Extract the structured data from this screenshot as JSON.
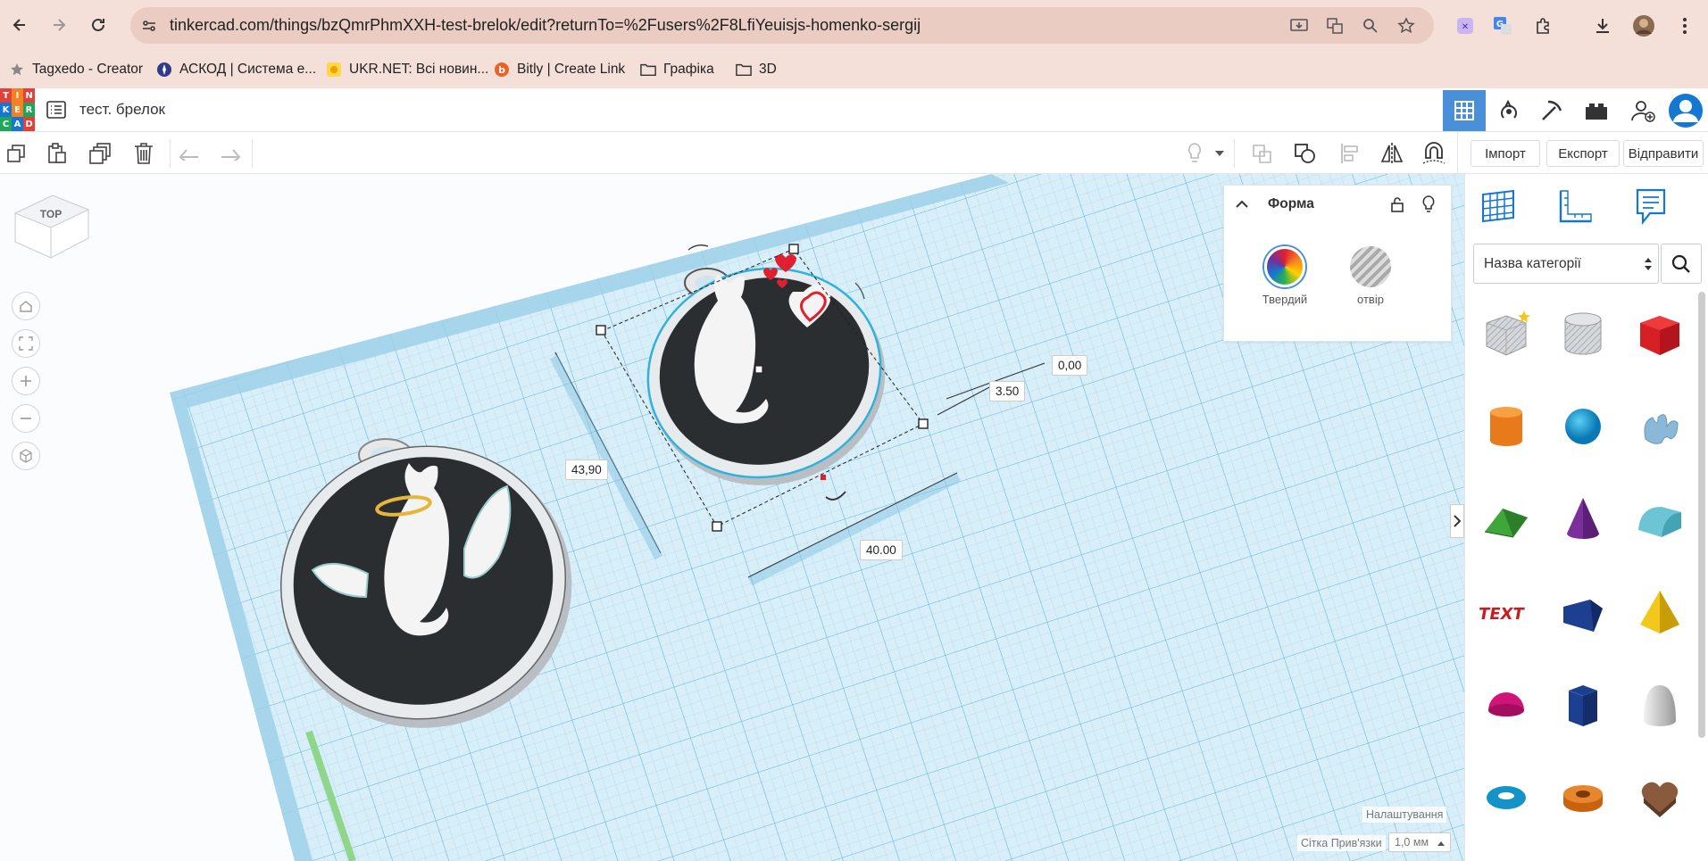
{
  "browser": {
    "url": "tinkercad.com/things/bzQmrPhmXXH-test-brelok/edit?returnTo=%2Fusers%2F8LfiYeuisjs-homenko-sergij",
    "bookmarks": [
      {
        "label": "Tagxedo - Creator",
        "icon": "star-icon"
      },
      {
        "label": "АСКОД | Система е...",
        "icon": "askod-icon"
      },
      {
        "label": "UKR.NET: Всі новин...",
        "icon": "ukrnet-icon"
      },
      {
        "label": "Bitly | Create Link",
        "icon": "bitly-icon"
      },
      {
        "label": "Графіка",
        "icon": "folder-icon"
      },
      {
        "label": "3D",
        "icon": "folder-icon"
      }
    ]
  },
  "app": {
    "logo_letters": [
      "T",
      "I",
      "N",
      "K",
      "E",
      "R",
      "C",
      "A",
      "D"
    ],
    "doc_title": "тест. брелок"
  },
  "toolbar": {
    "import": "Імпорт",
    "export": "Експорт",
    "send": "Відправити"
  },
  "viewport": {
    "viewcube_label": "TOP",
    "dims": {
      "height_label": "43,90",
      "width_label": "40.00",
      "depth_label": "3.50",
      "elev_label": "0,00"
    },
    "settings_label": "Налаштування",
    "grid_snap_label": "Сітка Прив'язки",
    "grid_snap_value": "1,0 мм"
  },
  "shape_panel": {
    "title": "Форма",
    "solid_label": "Твердий",
    "hole_label": "отвір"
  },
  "sidebar": {
    "category_placeholder": "Назва категорії",
    "shapes": [
      "box-hole",
      "cylinder-hole",
      "box",
      "cylinder",
      "sphere",
      "scribble",
      "roof",
      "cone",
      "round-roof",
      "text",
      "wedge",
      "pyramid",
      "half-sphere",
      "polygon",
      "paraboloid",
      "torus",
      "tube",
      "heart"
    ]
  },
  "colors": {
    "accent": "#4a90d9",
    "brand": "#1477d1"
  }
}
